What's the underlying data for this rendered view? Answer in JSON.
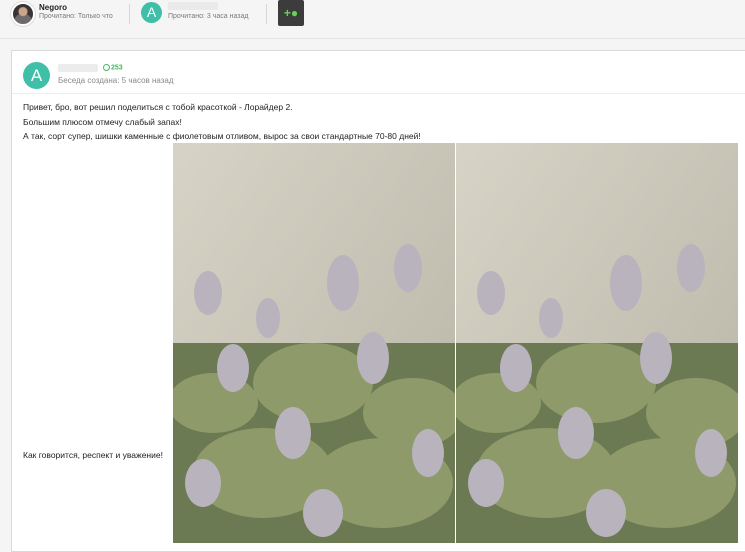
{
  "participants": [
    {
      "name": "Negoro",
      "status": "Прочитано: Только что"
    },
    {
      "avatar_letter": "A",
      "status": "Прочитано: 3 часа назад"
    }
  ],
  "add_participant_icon": "add-user-icon",
  "message": {
    "avatar_letter": "A",
    "reputation": "253",
    "created": "Беседа создана: 5 часов назад",
    "lines": [
      "Привет, бро, вот решил поделиться с тобой красоткой - Лорайдер 2.",
      "Большим плюсом отмечу слабый запах!",
      "А так, сорт супер, шишки каменные с фиолетовым отливом, вырос за свои стандартные 70-80 дней!",
      "Как говорится, респект и уважение!"
    ]
  },
  "colors": {
    "accent": "#3fbfa7",
    "reputation": "#43b85c",
    "button_bg": "#3c3c3c"
  }
}
